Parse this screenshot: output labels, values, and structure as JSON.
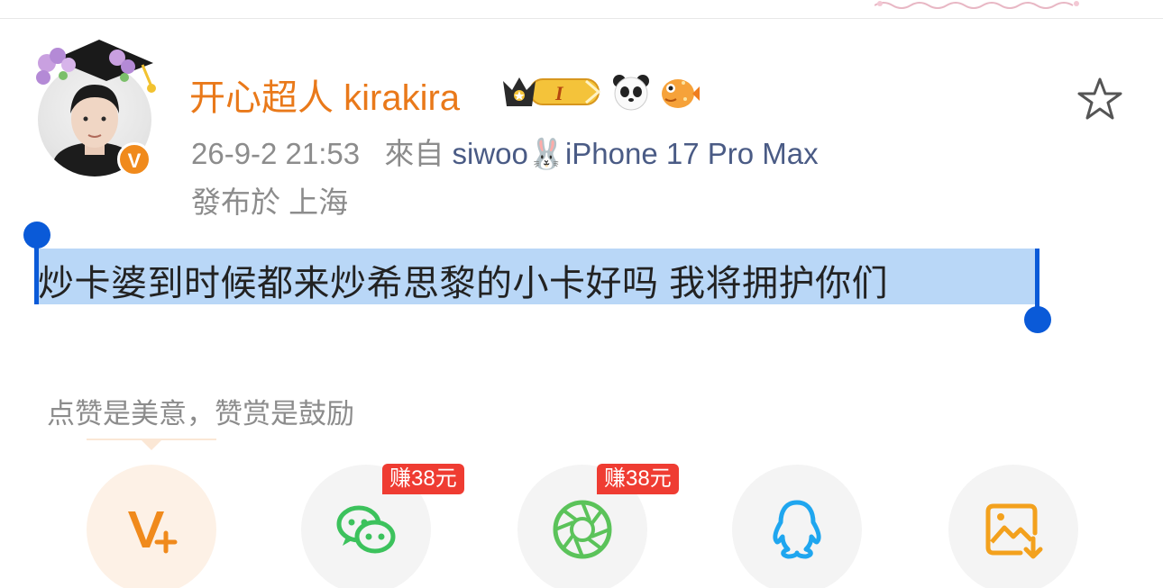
{
  "user": {
    "name": "开心超人 kirakira",
    "verified_badge": "V"
  },
  "meta": {
    "datetime": "26-9-2 21:53",
    "from_label": "來自",
    "source": "siwoo🐰iPhone 17 Pro Max",
    "location": "發布於 上海"
  },
  "post": {
    "text": "炒卡婆到时候都来炒希思黎的小卡好吗 我将拥护你们"
  },
  "tip": "点赞是美意，赞赏是鼓励",
  "share": {
    "reward_wechat": "赚38元",
    "reward_moments": "赚38元"
  },
  "colors": {
    "username": "#e9791a",
    "selection": "#b9d7f7",
    "handle": "#0a5ad8",
    "reward_badge": "#ef3c32",
    "wechat": "#3cc25c",
    "qq": "#1fa6ef",
    "save": "#f3a11d"
  },
  "icons": [
    "star-icon",
    "crown-level-badge-icon",
    "panda-emoji-icon",
    "pufferfish-emoji-icon",
    "rabbit-emoji-icon",
    "vplus-icon",
    "wechat-icon",
    "moments-icon",
    "qq-icon",
    "save-image-icon"
  ]
}
